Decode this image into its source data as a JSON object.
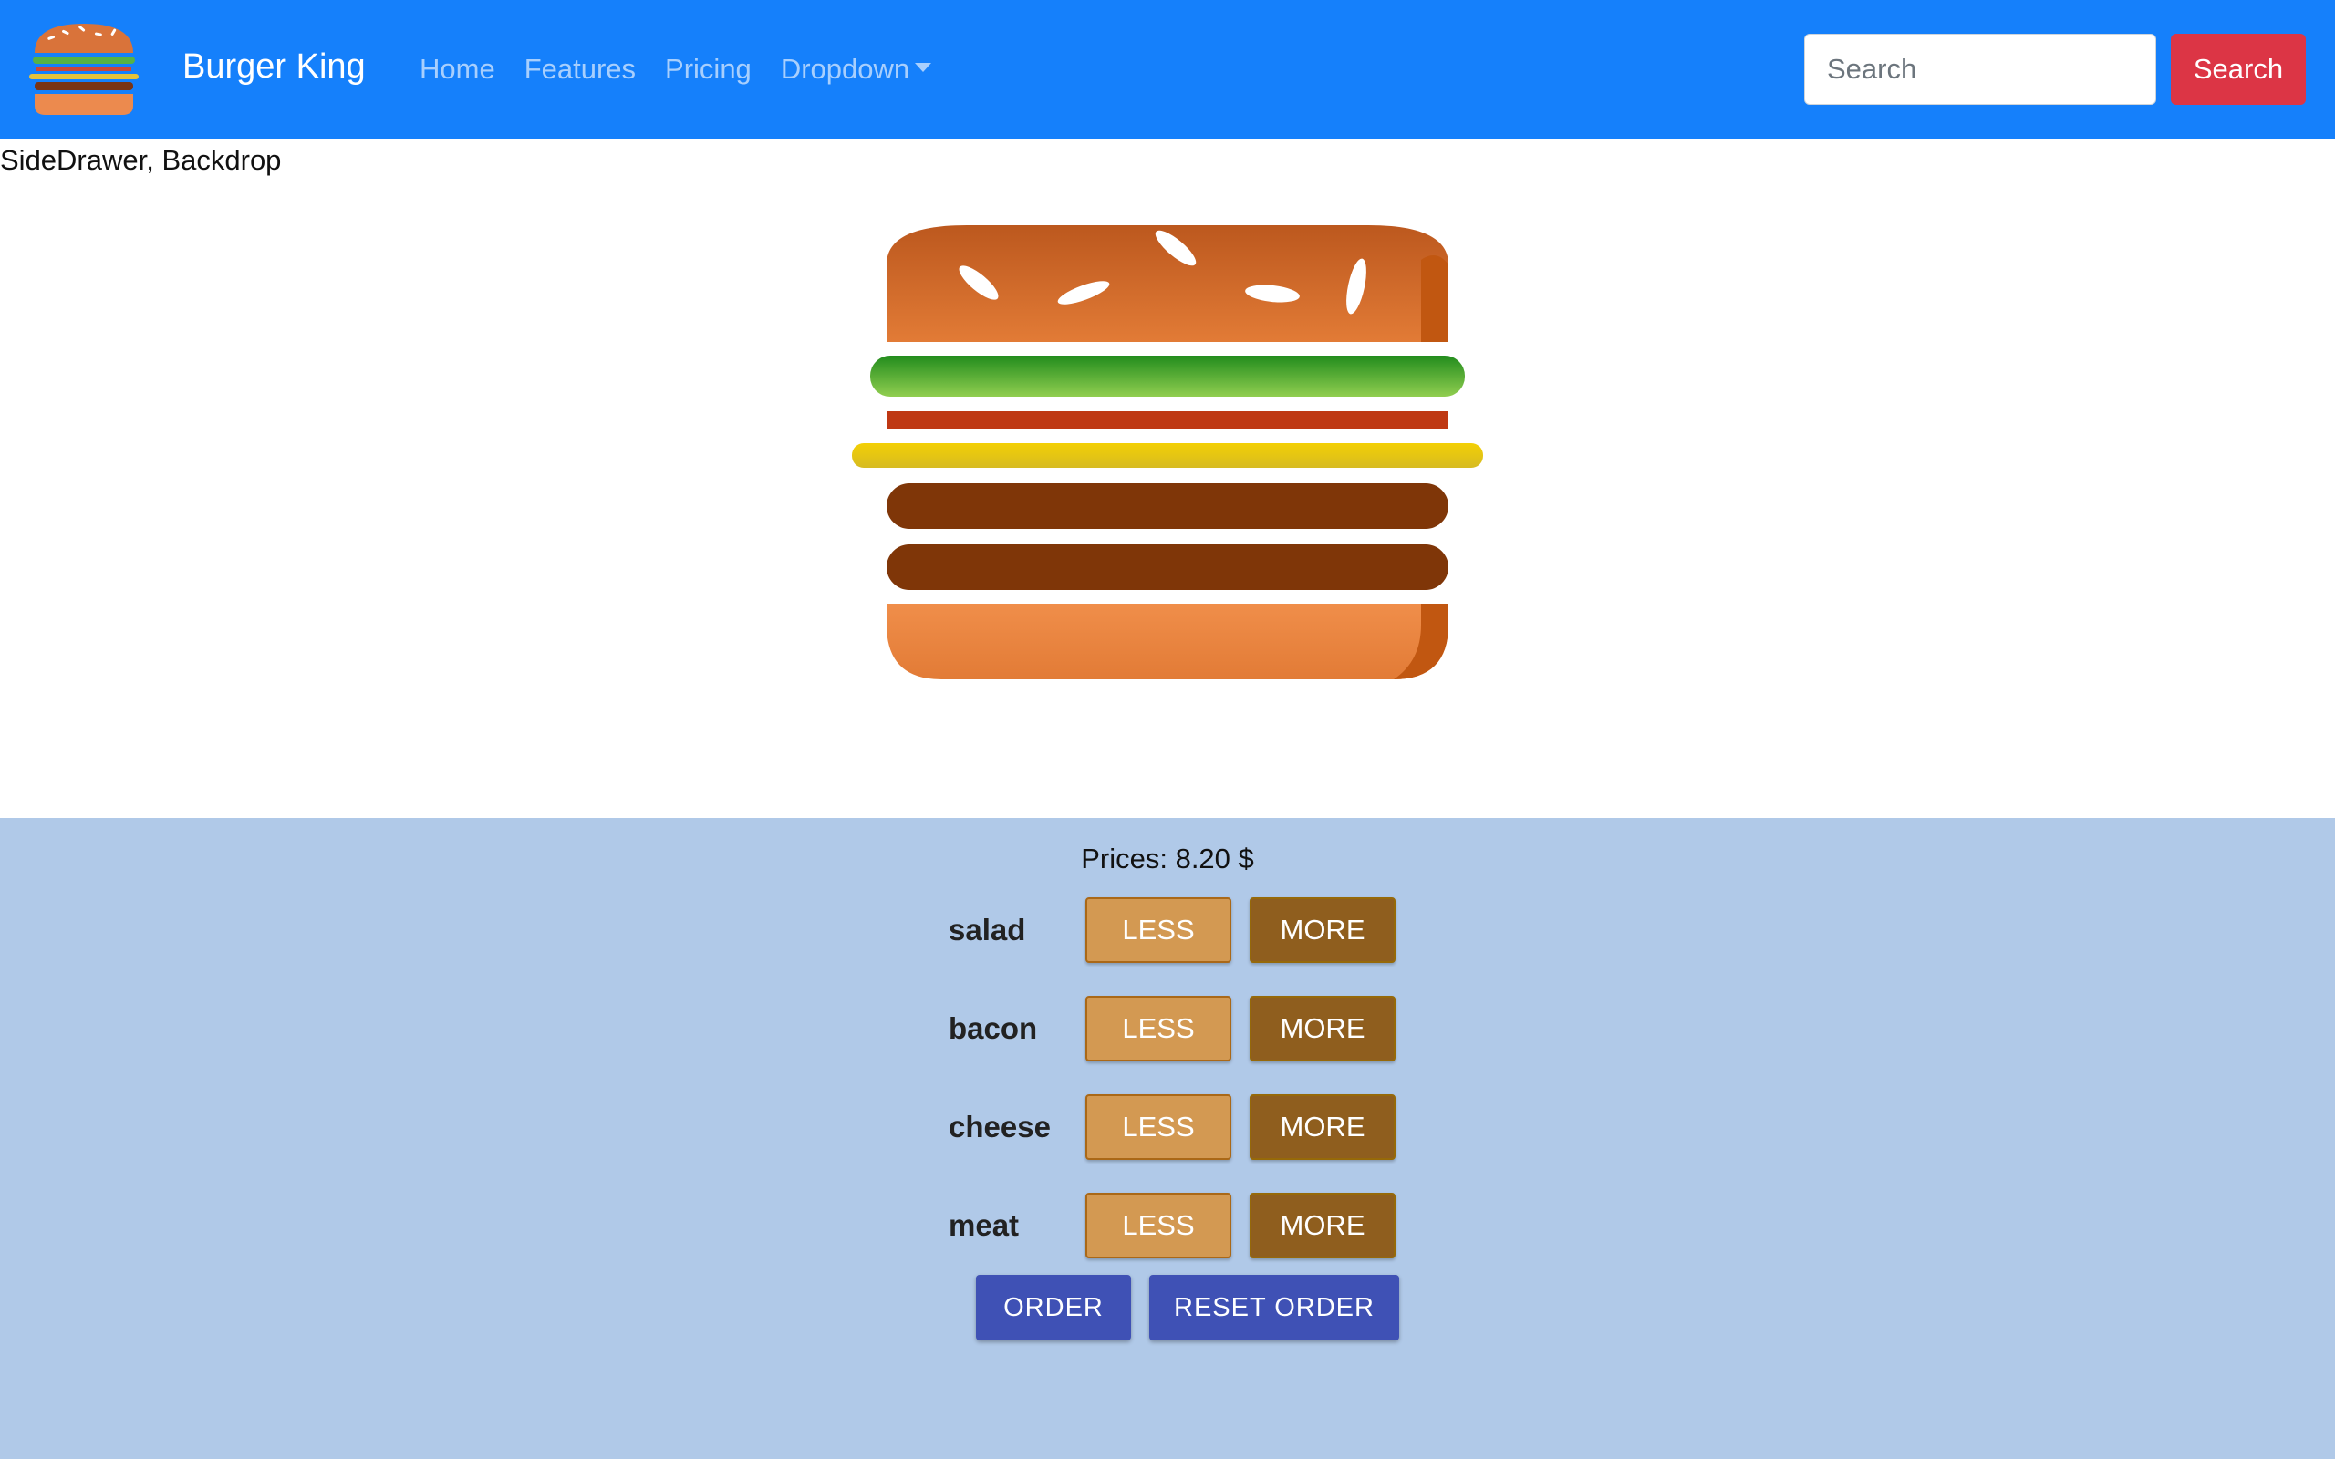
{
  "navbar": {
    "brand": "Burger King",
    "links": [
      {
        "label": "Home"
      },
      {
        "label": "Features"
      },
      {
        "label": "Pricing"
      },
      {
        "label": "Dropdown"
      }
    ],
    "search_placeholder": "Search",
    "search_button": "Search"
  },
  "side_text": "SideDrawer, Backdrop",
  "build_controls": {
    "price_text": "Prices: 8.20 $",
    "ingredients": [
      {
        "label": "salad",
        "less": "LESS",
        "more": "MORE"
      },
      {
        "label": "bacon",
        "less": "LESS",
        "more": "MORE"
      },
      {
        "label": "cheese",
        "less": "LESS",
        "more": "MORE"
      },
      {
        "label": "meat",
        "less": "LESS",
        "more": "MORE"
      }
    ],
    "order_button": "ORDER",
    "reset_button": "RESET ORDER"
  },
  "colors": {
    "navbar": "#1580fb",
    "search_button": "#dc3545",
    "controls_background": "#b0c9e8",
    "less_button": "#d39952",
    "more_button": "#8f5e1e",
    "order_button": "#3f51b5"
  }
}
